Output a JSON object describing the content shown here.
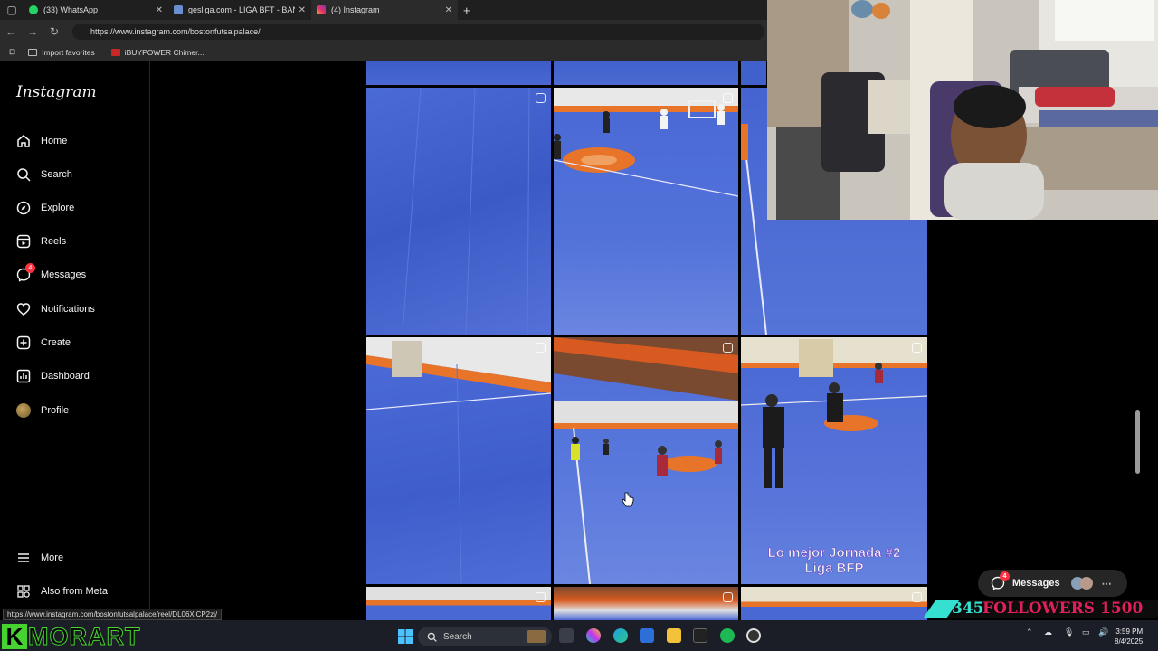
{
  "browser": {
    "tabs": [
      {
        "label": "(33) WhatsApp",
        "color": "#25d366"
      },
      {
        "label": "gesliga.com - LIGA BFT - BANQUE",
        "color": "#6a8fd1"
      },
      {
        "label": "(4) Instagram",
        "color": "#e1306c"
      }
    ],
    "new_tab": "+",
    "url": "https://www.instagram.com/bostonfutsalpalace/",
    "bookmarks": [
      "Import favorites",
      "iBUYPOWER Chimer..."
    ]
  },
  "sidebar": {
    "logo": "Instagram",
    "items": [
      {
        "label": "Home",
        "icon": "home-icon"
      },
      {
        "label": "Search",
        "icon": "search-icon"
      },
      {
        "label": "Explore",
        "icon": "compass-icon"
      },
      {
        "label": "Reels",
        "icon": "reels-icon"
      },
      {
        "label": "Messages",
        "icon": "messenger-icon",
        "badge": "4"
      },
      {
        "label": "Notifications",
        "icon": "heart-icon"
      },
      {
        "label": "Create",
        "icon": "plus-square-icon"
      },
      {
        "label": "Dashboard",
        "icon": "dashboard-icon"
      },
      {
        "label": "Profile",
        "icon": "avatar-icon"
      }
    ],
    "more": "More",
    "also_from_meta": "Also from Meta"
  },
  "feed": {
    "caption_overlay_line1": "Lo mejor Jornada #2",
    "caption_overlay_line2": "Liga BFP"
  },
  "status_bar_url": "https://www.instagram.com/bostonfutsalpalace/reel/DL06XiCP2zj/",
  "messages_pill": {
    "label": "Messages",
    "badge": "4"
  },
  "stream_overlay": {
    "followers_count": "345",
    "followers_label": "FOLLOWERS",
    "followers_goal": "1500",
    "brand_k": "K",
    "brand_name": "MORART"
  },
  "taskbar": {
    "search_placeholder": "Search",
    "time": "3:59 PM",
    "date": "8/4/2025"
  },
  "colors": {
    "court_blue": "#3f5fd0",
    "court_orange": "#e8742a",
    "brand_green": "#46d330",
    "follower_red": "#e0205a",
    "follower_cyan": "#36e0d0"
  }
}
